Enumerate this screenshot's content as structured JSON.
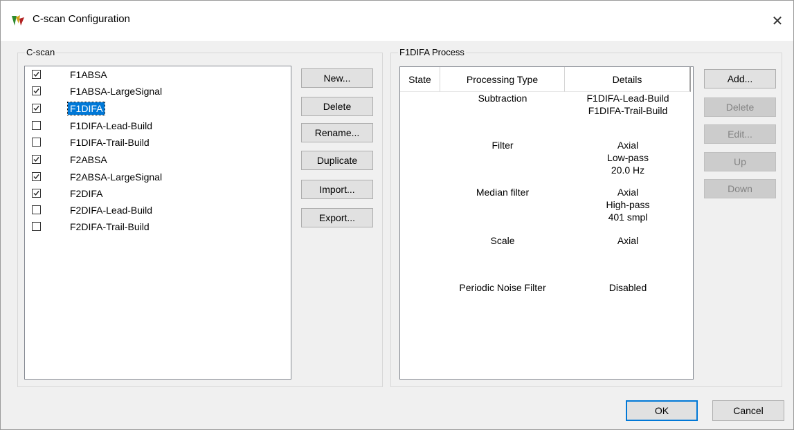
{
  "window": {
    "title": "C-scan Configuration",
    "close_glyph": "✕"
  },
  "cscan": {
    "label": "C-scan",
    "items": [
      {
        "label": "F1ABSA",
        "checked": true,
        "selected": false
      },
      {
        "label": "F1ABSA-LargeSignal",
        "checked": true,
        "selected": false
      },
      {
        "label": "F1DIFA",
        "checked": true,
        "selected": true
      },
      {
        "label": "F1DIFA-Lead-Build",
        "checked": false,
        "selected": false
      },
      {
        "label": "F1DIFA-Trail-Build",
        "checked": false,
        "selected": false
      },
      {
        "label": "F2ABSA",
        "checked": true,
        "selected": false
      },
      {
        "label": "F2ABSA-LargeSignal",
        "checked": true,
        "selected": false
      },
      {
        "label": "F2DIFA",
        "checked": true,
        "selected": false
      },
      {
        "label": "F2DIFA-Lead-Build",
        "checked": false,
        "selected": false
      },
      {
        "label": "F2DIFA-Trail-Build",
        "checked": false,
        "selected": false
      }
    ],
    "buttons": {
      "new": "New...",
      "delete": "Delete",
      "rename": "Rename...",
      "duplicate": "Duplicate",
      "import": "Import...",
      "export": "Export..."
    }
  },
  "process": {
    "label": "F1DIFA Process",
    "columns": {
      "state": "State",
      "type": "Processing Type",
      "details": "Details"
    },
    "rows": [
      {
        "type": "Subtraction",
        "details": [
          "F1DIFA-Lead-Build",
          "F1DIFA-Trail-Build"
        ]
      },
      {
        "type": "Filter",
        "details": [
          "Axial",
          "Low-pass",
          "20.0 Hz"
        ]
      },
      {
        "type": "Median filter",
        "details": [
          "Axial",
          "High-pass",
          "401 smpl"
        ]
      },
      {
        "type": "Scale",
        "details": [
          "Axial"
        ]
      },
      {
        "type": "Periodic Noise Filter",
        "details": [
          "Disabled"
        ]
      }
    ],
    "buttons": {
      "add": "Add...",
      "delete": "Delete",
      "edit": "Edit...",
      "up": "Up",
      "down": "Down"
    }
  },
  "footer": {
    "ok": "OK",
    "cancel": "Cancel"
  },
  "colors": {
    "selection": "#0078d7",
    "dialog_bg": "#f0f0f0",
    "default_button_border": "#0078d7"
  }
}
